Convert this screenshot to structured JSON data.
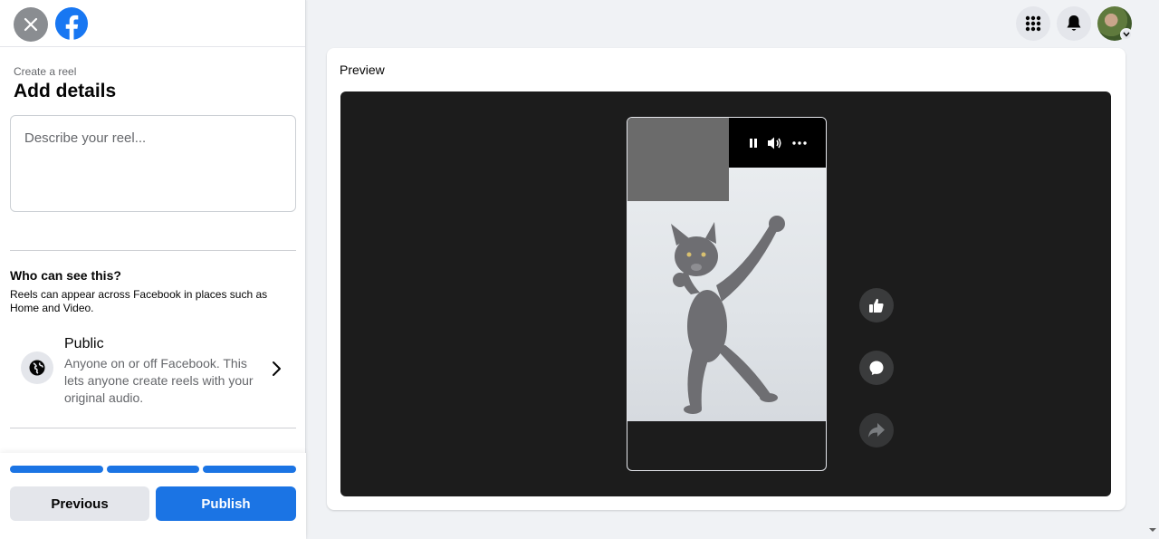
{
  "sidebar": {
    "breadcrumb": "Create a reel",
    "title": "Add details",
    "description_placeholder": "Describe your reel...",
    "description_value": "",
    "audience": {
      "heading": "Who can see this?",
      "subtext": "Reels can appear across Facebook in places such as Home and Video.",
      "option_title": "Public",
      "option_desc": "Anyone on or off Facebook. This lets anyone create reels with your original audio."
    },
    "progress_steps_completed": 3,
    "progress_steps_total": 3,
    "buttons": {
      "previous": "Previous",
      "publish": "Publish"
    }
  },
  "preview": {
    "title": "Preview"
  },
  "colors": {
    "accent": "#1b74e4",
    "stage": "#1c1c1c",
    "page_bg": "#f0f2f5"
  },
  "icons": {
    "close": "close-icon",
    "logo": "facebook-logo-icon",
    "globe": "globe-icon",
    "chevron": "chevron-right-icon",
    "menu": "grid-menu-icon",
    "notifications": "bell-icon",
    "pause": "pause-icon",
    "volume": "volume-icon",
    "more": "more-icon",
    "like": "like-icon",
    "comment": "comment-icon",
    "share": "share-icon"
  }
}
